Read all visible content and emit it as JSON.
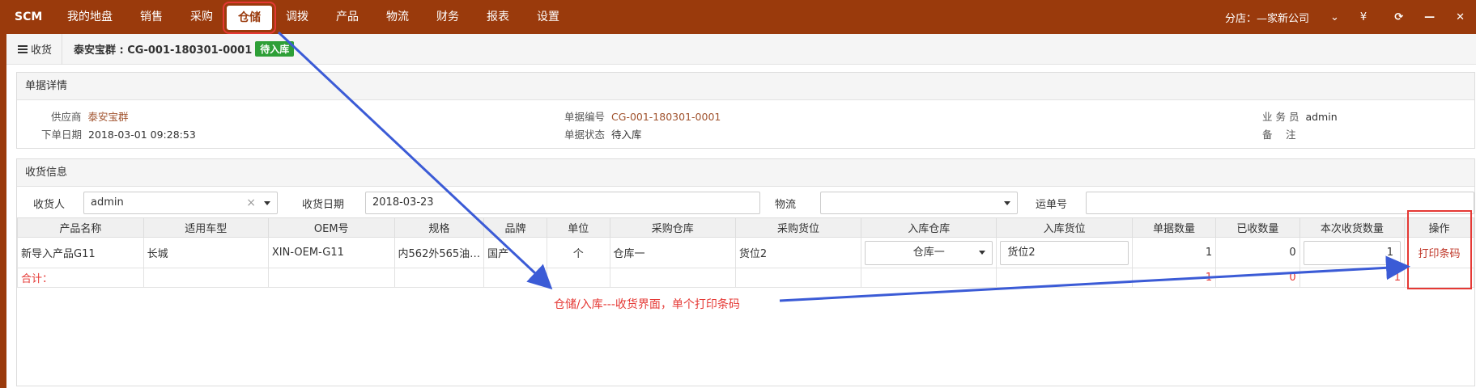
{
  "nav": {
    "brand": "SCM",
    "items": [
      "我的地盘",
      "销售",
      "采购",
      "仓储",
      "调拨",
      "产品",
      "物流",
      "财务",
      "报表",
      "设置"
    ],
    "active": "仓储",
    "branch": "分店：—家新公司",
    "currency": "¥",
    "refresh_icon": "⟳",
    "min_icon": "—",
    "close_icon": "✕",
    "chevron": "⌄"
  },
  "breadcrumb": {
    "home": "收货",
    "title": "泰安宝群 : CG-001-180301-0001",
    "status": "待入库"
  },
  "detail": {
    "heading": "单据详情",
    "supplier_label": "供应商",
    "supplier": "泰安宝群",
    "order_date_label": "下单日期",
    "order_date": "2018-03-01 09:28:53",
    "doc_no_label": "单据编号",
    "doc_no": "CG-001-180301-0001",
    "doc_status_label": "单据状态",
    "doc_status": "待入库",
    "salesman_label": "业 务 员",
    "salesman": "admin",
    "remark_label": "备　 注",
    "remark": ""
  },
  "receive": {
    "heading": "收货信息",
    "receiver_label": "收货人",
    "receiver": "admin",
    "receive_date_label": "收货日期",
    "receive_date": "2018-03-23",
    "logistics_label": "物流",
    "logistics": "",
    "waybill_label": "运单号",
    "waybill": "",
    "columns": [
      "产品名称",
      "适用车型",
      "OEM号",
      "规格",
      "品牌",
      "单位",
      "采购仓库",
      "采购货位",
      "入库仓库",
      "入库货位",
      "单据数量",
      "已收数量",
      "本次收货数量",
      "操作"
    ],
    "rows": [
      {
        "name": "新导入产品G11",
        "car": "长城",
        "oem": "XIN-OEM-G11",
        "spec": "内562外565油…",
        "brand": "国产",
        "unit": "个",
        "buy_wh": "仓库一",
        "buy_loc": "货位2",
        "in_wh": "仓库一",
        "in_loc": "货位2",
        "qty": "1",
        "received": "0",
        "this_qty": "1",
        "action": "打印条码"
      }
    ],
    "total_label": "合计：",
    "total_qty": "1",
    "total_received": "0",
    "total_this": "1"
  },
  "annotation": "仓储/入库---收货界面，单个打印条码",
  "colors": {
    "brand": "#9a3a0c",
    "badge": "#2e9f37",
    "highlight": "#e53935",
    "arrow": "#3b5bd6"
  }
}
